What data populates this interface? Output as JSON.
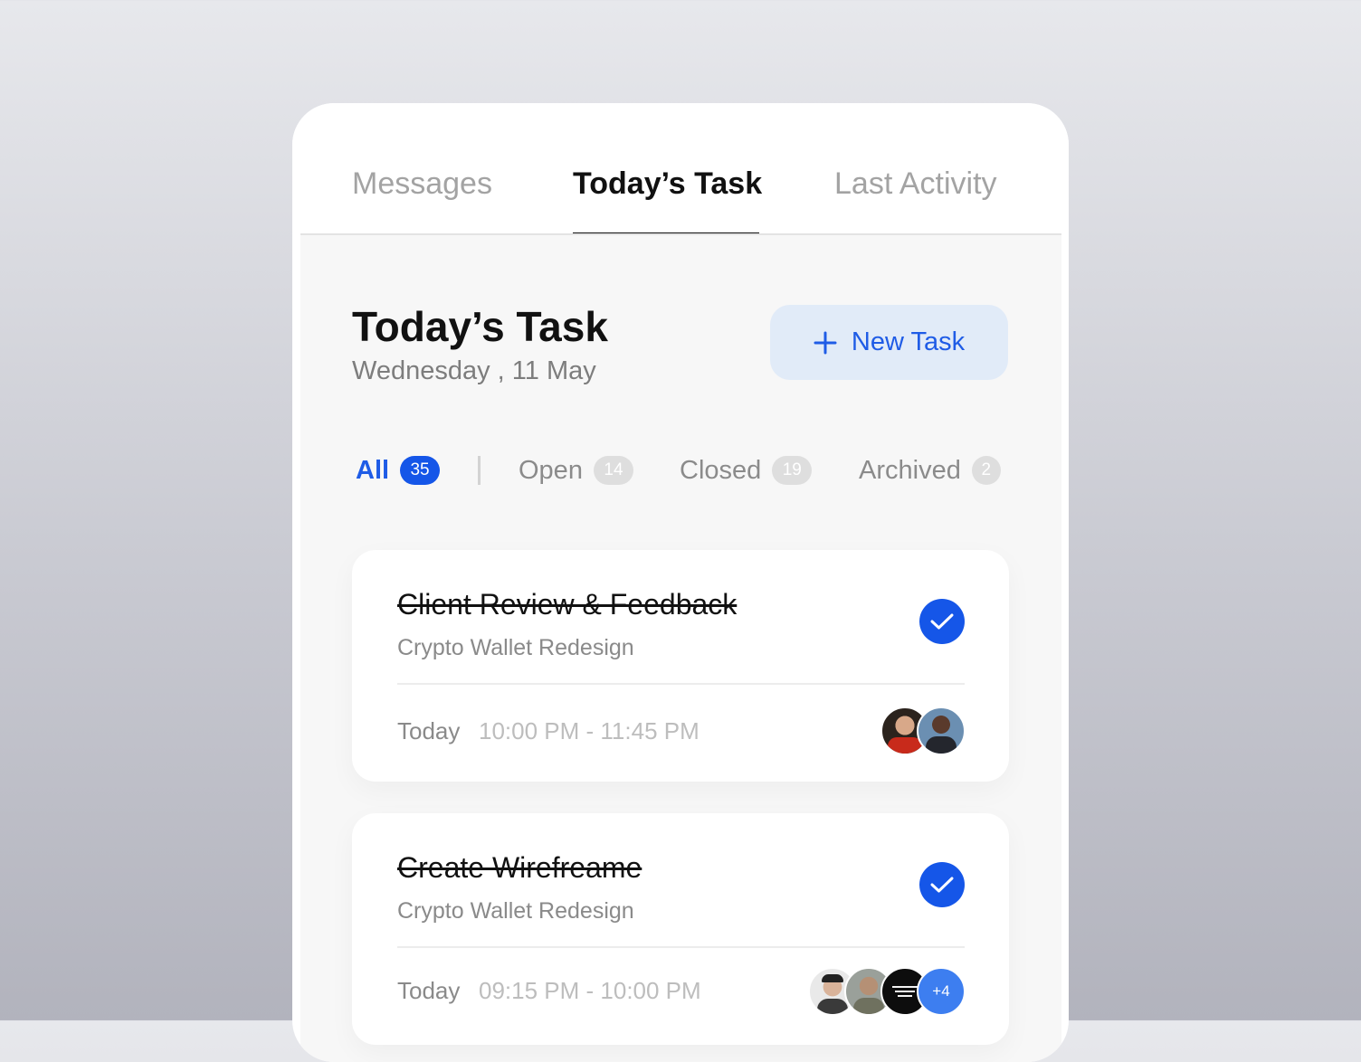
{
  "tabs": [
    {
      "label": "Messages",
      "active": false
    },
    {
      "label": "Today’s Task",
      "active": true
    },
    {
      "label": "Last Activity",
      "active": false
    }
  ],
  "header": {
    "title": "Today’s Task",
    "date": "Wednesday , 11 May",
    "new_task_label": "New Task"
  },
  "filters": [
    {
      "label": "All",
      "count": "35",
      "active": true
    },
    {
      "label": "Open",
      "count": "14",
      "active": false
    },
    {
      "label": "Closed",
      "count": "19",
      "active": false
    },
    {
      "label": "Archived",
      "count": "2",
      "active": false
    }
  ],
  "tasks": [
    {
      "title": "Client Review & Feedback",
      "project": "Crypto Wallet Redesign",
      "day": "Today",
      "time": "10:00 PM - 11:45 PM",
      "completed": true,
      "extra_count": ""
    },
    {
      "title": "Create Wirefreame",
      "project": "Crypto Wallet Redesign",
      "day": "Today",
      "time": "09:15 PM - 10:00 PM",
      "completed": true,
      "extra_count": "+4"
    }
  ],
  "colors": {
    "accent": "#1556e8",
    "accent_light": "#e1ebf8",
    "text_primary": "#111111",
    "text_secondary": "#8a8a8a"
  }
}
